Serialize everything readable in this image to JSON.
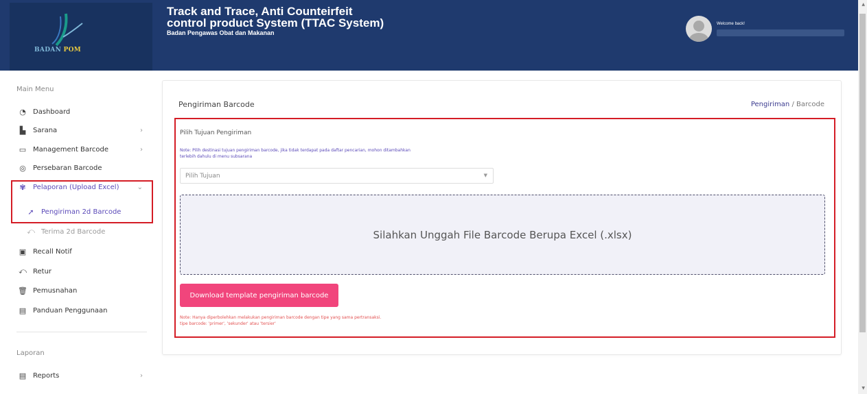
{
  "header": {
    "logo_text_a": "BADAN",
    "logo_text_b": "POM",
    "title_line1": "Track and Trace, Anti Counteirfeit",
    "title_line2": "control product System (TTAC System)",
    "subtitle": "Badan Pengawas Obat dan Makanan",
    "welcome": "Welcome back!"
  },
  "sidebar": {
    "main_heading": "Main Menu",
    "items": [
      {
        "label": "Dashboard",
        "icon": "dashboard-icon"
      },
      {
        "label": "Sarana",
        "icon": "building-icon",
        "has_chevron": true
      },
      {
        "label": "Management Barcode",
        "icon": "folder-icon",
        "has_chevron": true
      },
      {
        "label": "Persebaran Barcode",
        "icon": "location-pin-icon"
      },
      {
        "label": "Pelaporan (Upload Excel)",
        "icon": "report-icon",
        "has_chevron": true,
        "active": true
      },
      {
        "label": "Pengiriman 2d Barcode",
        "icon": "send-icon",
        "active": true,
        "sub": true
      },
      {
        "label": "Terima 2d Barcode",
        "icon": "receive-icon",
        "sub": true
      },
      {
        "label": "Recall Notif",
        "icon": "notification-icon"
      },
      {
        "label": "Retur",
        "icon": "return-icon"
      },
      {
        "label": "Pemusnahan",
        "icon": "trash-icon"
      },
      {
        "label": "Panduan Penggunaan",
        "icon": "guide-icon"
      }
    ],
    "report_heading": "Laporan",
    "reports_item": {
      "label": "Reports",
      "icon": "reports-icon"
    }
  },
  "main": {
    "card_title": "Pengiriman Barcode",
    "breadcrumb_link": "Pengiriman",
    "breadcrumb_sep": "/",
    "breadcrumb_current": "Barcode",
    "form_label": "Pilih Tujuan Pengiriman",
    "note_line1": "Note: Pilih destinasi tujuan pengiriman barcode, jika tidak terdapat pada daftar pencarian, mohon ditambahkan",
    "note_line2": "terlebih dahulu di menu subsarana",
    "select_placeholder": "Pilih Tujuan",
    "dropzone_text": "Silahkan Unggah File Barcode Berupa Excel (.xlsx)",
    "download_button": "Download template pengiriman barcode",
    "note2_line1": "Note: Hanya diperbolehkan melakukan pengiriman barcode dengan tipe yang sama pertransaksi.",
    "note2_line2": "tipe barcode: 'primer', 'sekunder' atau 'tersier'"
  },
  "colors": {
    "header_bg": "#1f3a6e",
    "accent_purple": "#5a49b8",
    "button_pink": "#f1457c",
    "highlight_red": "#d41c25"
  }
}
